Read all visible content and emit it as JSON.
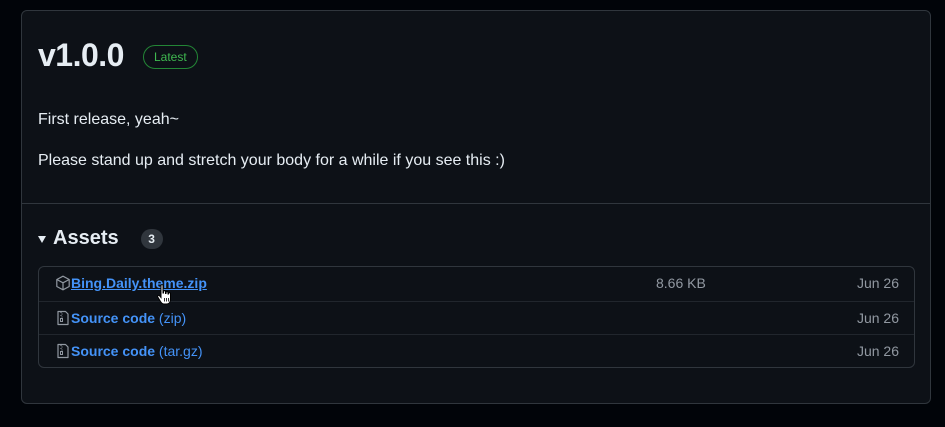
{
  "release": {
    "title": "v1.0.0",
    "badge": "Latest",
    "body": [
      "First release, yeah~",
      "Please stand up and stretch your body for a while if you see this :)"
    ]
  },
  "assets": {
    "title": "Assets",
    "count": "3",
    "items": [
      {
        "icon": "package-icon",
        "name": "Bing.Daily.theme.zip",
        "suffix": "",
        "size": "8.66 KB",
        "date": "Jun 26"
      },
      {
        "icon": "file-zip-icon",
        "name": "Source code",
        "suffix": "(zip)",
        "size": "",
        "date": "Jun 26"
      },
      {
        "icon": "file-zip-icon",
        "name": "Source code",
        "suffix": "(tar.gz)",
        "size": "",
        "date": "Jun 26"
      }
    ]
  },
  "colors": {
    "background": "#0d1117",
    "link": "#4493f8",
    "latest_green": "#3fb950",
    "muted": "#9198a1"
  }
}
